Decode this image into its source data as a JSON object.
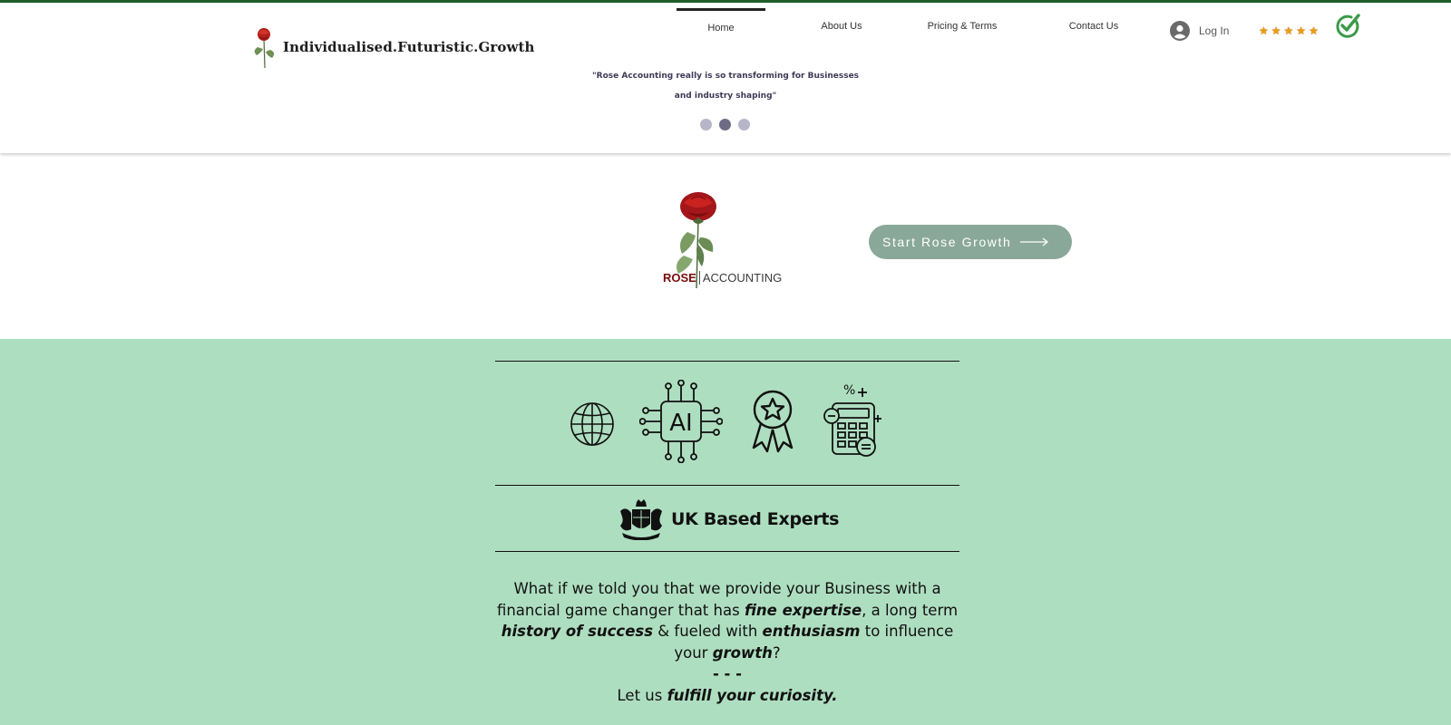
{
  "header": {
    "brand_text": "Individualised.Futuristic.Growth",
    "nav": [
      {
        "label": "Home",
        "active": true
      },
      {
        "label": "About Us",
        "active": false
      },
      {
        "label": "Pricing & Terms",
        "active": false
      },
      {
        "label": "Contact Us",
        "active": false
      }
    ],
    "login_label": "Log In",
    "rating_stars": 5,
    "quote_line1": "\"Rose Accounting really is so transforming for Businesses",
    "quote_line2": "and industry shaping\"",
    "slider": {
      "count": 3,
      "active_index": 1
    }
  },
  "hero": {
    "logo_rose": "ROSE",
    "logo_accounting": "ACCOUNTING",
    "cta_label": "Start Rose Growth"
  },
  "features": {
    "icons": [
      "globe-icon",
      "ai-chip-icon",
      "award-ribbon-icon",
      "calculator-icon"
    ],
    "uk_bold": "UK",
    "uk_rest": "Based Experts",
    "paragraph": {
      "p1": "What if we told you that we provide your Business with a financial game changer that has ",
      "b1": "fine expertise",
      "p2": ", a long term ",
      "b2": "history of success",
      "p3": " & fueled with ",
      "b3": "enthusiasm",
      "p4": " to influence your ",
      "b4": "growth",
      "p5": "?",
      "sep": "- - -",
      "p6": "Let us ",
      "b6": "fulfill your curiosity."
    }
  },
  "colors": {
    "top_line": "#1f5e2b",
    "green_section": "#aedec0",
    "cta_bg": "#8aa89a",
    "check": "#3a9a47",
    "rose_red": "#7a0d0d"
  }
}
